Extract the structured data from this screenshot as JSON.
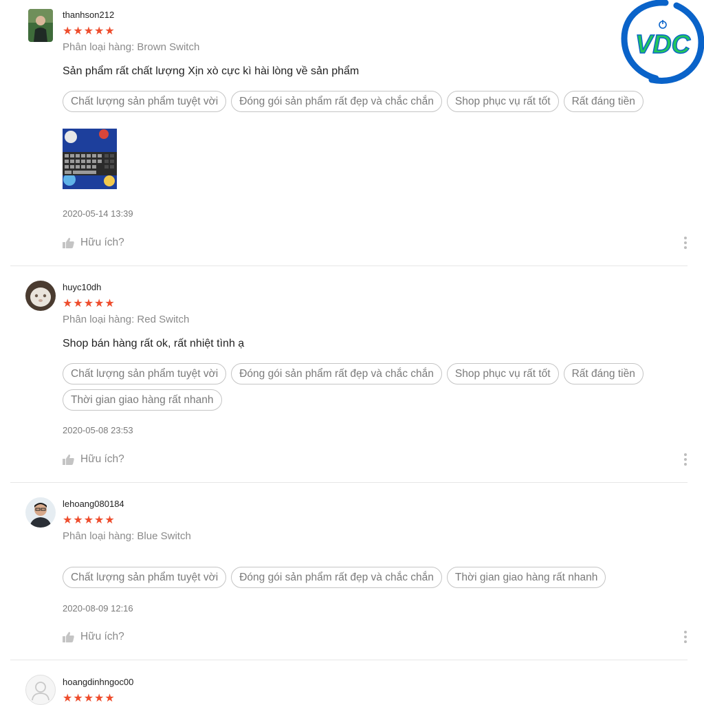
{
  "brand": {
    "logo_text": "VDC",
    "colors": {
      "logo_blue": "#0a63c9",
      "logo_green": "#22c55e"
    }
  },
  "theme": {
    "star_color": "#ee4d2d",
    "tag_border": "#c4c4c4",
    "muted_text": "#8a8a8a"
  },
  "reviews": [
    {
      "username": "thanhson212",
      "rating": 5,
      "stars": "★★★★★",
      "variation": "Phân loại hàng: Brown Switch",
      "comment": "Sản phẩm rất chất lượng Xịn xò cực kì hài lòng về sản phẩm",
      "tags": [
        "Chất lượng sản phẩm tuyệt vời",
        "Đóng gói sản phẩm rất đẹp và chắc chắn",
        "Shop phục vụ rất tốt",
        "Rất đáng tiền"
      ],
      "has_photo": true,
      "timestamp": "2020-05-14 13:39",
      "helpful_label": "Hữu ích?"
    },
    {
      "username": "huyc10dh",
      "rating": 5,
      "stars": "★★★★★",
      "variation": "Phân loại hàng: Red Switch",
      "comment": "Shop bán hàng rất ok, rất nhiệt tình ạ",
      "tags": [
        "Chất lượng sản phẩm tuyệt vời",
        "Đóng gói sản phẩm rất đẹp và chắc chắn",
        "Shop phục vụ rất tốt",
        "Rất đáng tiền",
        "Thời gian giao hàng rất nhanh"
      ],
      "timestamp": "2020-05-08 23:53",
      "helpful_label": "Hữu ích?"
    },
    {
      "username": "lehoang080184",
      "rating": 5,
      "stars": "★★★★★",
      "variation": "Phân loại hàng: Blue Switch",
      "comment": "",
      "tags": [
        "Chất lượng sản phẩm tuyệt vời",
        "Đóng gói sản phẩm rất đẹp và chắc chắn",
        "Thời gian giao hàng rất nhanh"
      ],
      "timestamp": "2020-08-09 12:16",
      "helpful_label": "Hữu ích?"
    },
    {
      "username": "hoangdinhngoc00",
      "rating": 5,
      "stars": "★★★★★"
    }
  ],
  "icons": {
    "helpful": "thumbs-up-icon",
    "more": "more-vertical-icon",
    "default_avatar": "user-icon"
  }
}
